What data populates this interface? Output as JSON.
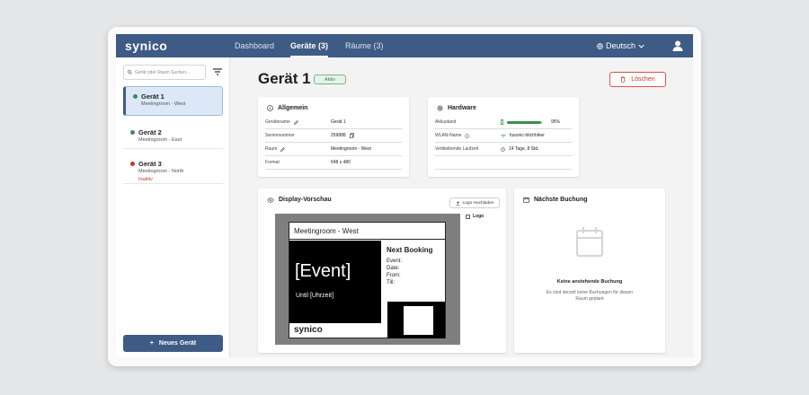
{
  "app": {
    "logo": "synico"
  },
  "nav": {
    "dashboard": "Dashboard",
    "devices": "Geräte (3)",
    "rooms": "Räume (3)",
    "language": "Deutsch"
  },
  "sidebar": {
    "search_placeholder": "Gerät oder Raum Suchen...",
    "devices": [
      {
        "name": "Gerät 1",
        "room": "Meetingroom - West",
        "status": "",
        "dot": "#3c8d4f"
      },
      {
        "name": "Gerät 2",
        "room": "Meetingroom - East",
        "status": "",
        "dot": "#3c8d4f"
      },
      {
        "name": "Gerät 3",
        "room": "Meetingroom - North",
        "status": "Inaktiv",
        "dot": "#c0392b"
      }
    ],
    "new_device": "Neues Gerät"
  },
  "header": {
    "title": "Gerät 1",
    "badge": "Aktiv",
    "delete": "Löschen"
  },
  "general": {
    "title": "Allgemein",
    "rows": [
      {
        "key": "Gerätename",
        "value": "Gerät 1"
      },
      {
        "key": "Seriennummer",
        "value": "259888"
      },
      {
        "key": "Raum",
        "value": "Meetingroom - West"
      },
      {
        "key": "Format",
        "value": "648 x 480"
      }
    ]
  },
  "hardware": {
    "title": "Hardware",
    "rows": [
      {
        "key": "Akkustand",
        "value": "95%"
      },
      {
        "key": "WLAN-Name",
        "value": "fusonic-hitchhiker"
      },
      {
        "key": "Verbleibende Laufzeit",
        "value": "14 Tage, 8 Std."
      }
    ],
    "battery_level": 0.95
  },
  "preview": {
    "title": "Display-Vorschau",
    "upload": "Logo Hochladen",
    "logo_label": "Logo",
    "room": "Meetingroom - West",
    "event": "[Event]",
    "until": "Until [Uhrzeit]",
    "next_title": "Next Booking",
    "next_labels": [
      "Event:",
      "Date:",
      "From:",
      "Till:"
    ],
    "footer_logo": "synico"
  },
  "booking": {
    "title": "Nächste Buchung",
    "empty_title": "Keine anstehende Buchung",
    "empty_text": "Es sind derzeit keine Buchungen für diesen Raum geplant"
  },
  "colors": {
    "brand": "#3d5b85",
    "active": "#3c8d4f",
    "danger": "#c0392b"
  }
}
